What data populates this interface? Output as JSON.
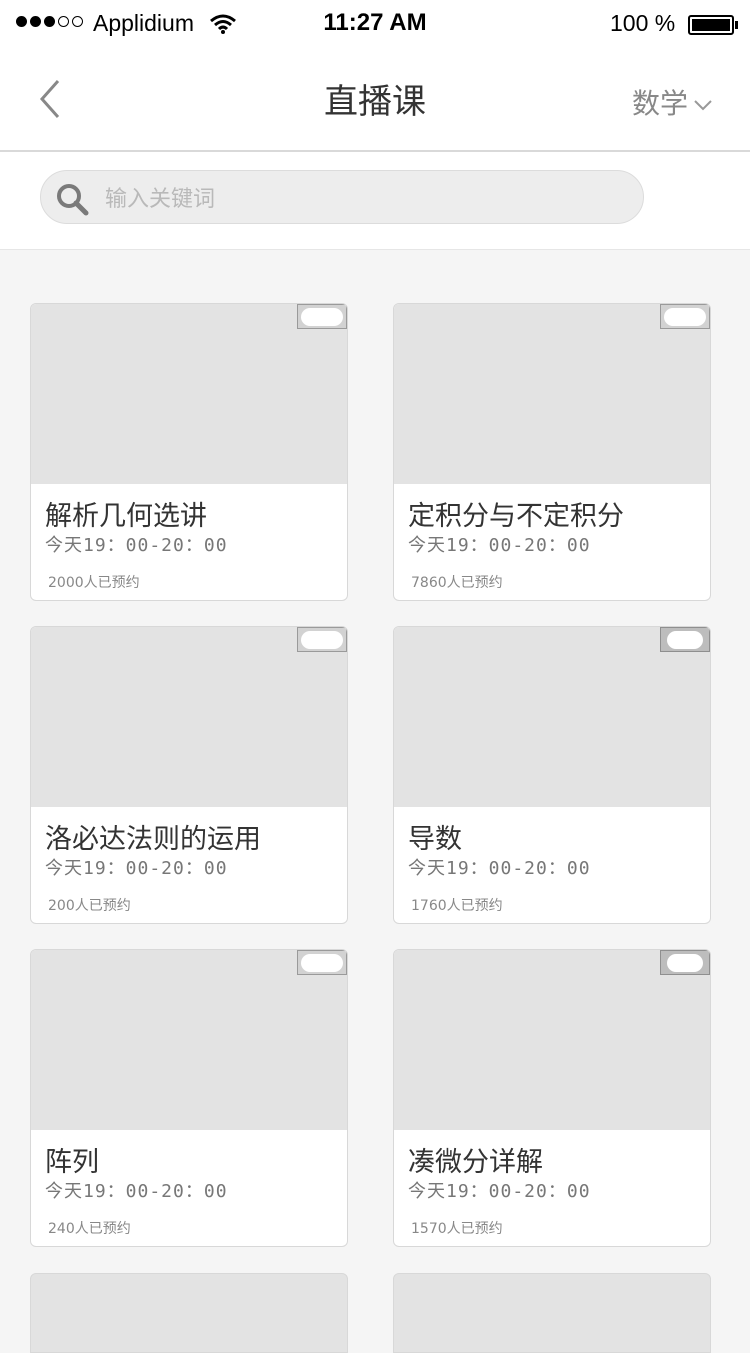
{
  "status_bar": {
    "carrier": "Applidium",
    "time": "11:27 AM",
    "battery": "100 %"
  },
  "nav": {
    "title": "直播课",
    "subject": "数学"
  },
  "search": {
    "placeholder": "输入关键词",
    "value": ""
  },
  "courses": [
    {
      "title": "解析几何选讲",
      "time": "今天19：00-20：00",
      "bookings": "2000人已预约"
    },
    {
      "title": "定积分与不定积分",
      "time": "今天19：00-20：00",
      "bookings": "7860人已预约"
    },
    {
      "title": "洛必达法则的运用",
      "time": "今天19：00-20：00",
      "bookings": "200人已预约"
    },
    {
      "title": "导数",
      "time": "今天19：00-20：00",
      "bookings": "1760人已预约"
    },
    {
      "title": "阵列",
      "time": "今天19：00-20：00",
      "bookings": "240人已预约"
    },
    {
      "title": "凑微分详解",
      "time": "今天19：00-20：00",
      "bookings": "1570人已预约"
    }
  ],
  "icons": {
    "back": "chevron-left-icon",
    "subject_dropdown": "chevron-down-icon",
    "search": "search-icon",
    "wifi": "wifi-icon",
    "battery": "battery-icon"
  },
  "colors": {
    "background": "#f5f5f5",
    "thumbnail": "#e3e3e3",
    "text": "#333333",
    "muted": "#888888"
  }
}
